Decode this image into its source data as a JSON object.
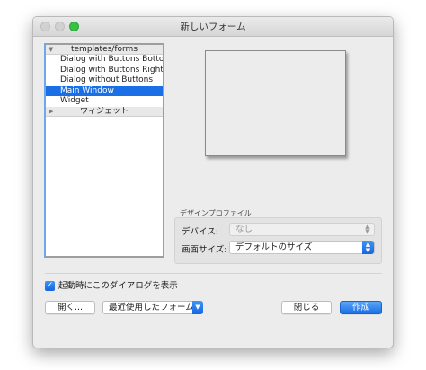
{
  "window": {
    "title": "新しいフォーム"
  },
  "templates": {
    "group_label": "templates/forms",
    "items": [
      "Dialog with Buttons Bottom",
      "Dialog with Buttons Right",
      "Dialog without Buttons",
      "Main Window",
      "Widget"
    ],
    "selected": "Main Window",
    "widgets_group_label": "ウィジェット"
  },
  "design_profile": {
    "section_label": "デザインプロファイル",
    "device_label": "デバイス:",
    "device_value": "なし",
    "screen_size_label": "画面サイズ:",
    "screen_size_value": "デフォルトのサイズ"
  },
  "startup": {
    "checkbox_label": "起動時にこのダイアログを表示",
    "checked": true
  },
  "buttons": {
    "open": "開く...",
    "recent": "最近使用したフォーム",
    "close": "閉じる",
    "create": "作成"
  },
  "colors": {
    "selection": "#1a6ee6",
    "accent_blue": "#1565e0",
    "window_bg": "#ececec",
    "zoom_green": "#37c244"
  },
  "icons": {
    "group_expanded": "triangle-down-icon",
    "group_collapsed": "triangle-right-icon",
    "checkbox": "checkmark-icon",
    "select_stepper": "up-down-chevron-icon",
    "dropdown": "chevron-down-icon"
  }
}
